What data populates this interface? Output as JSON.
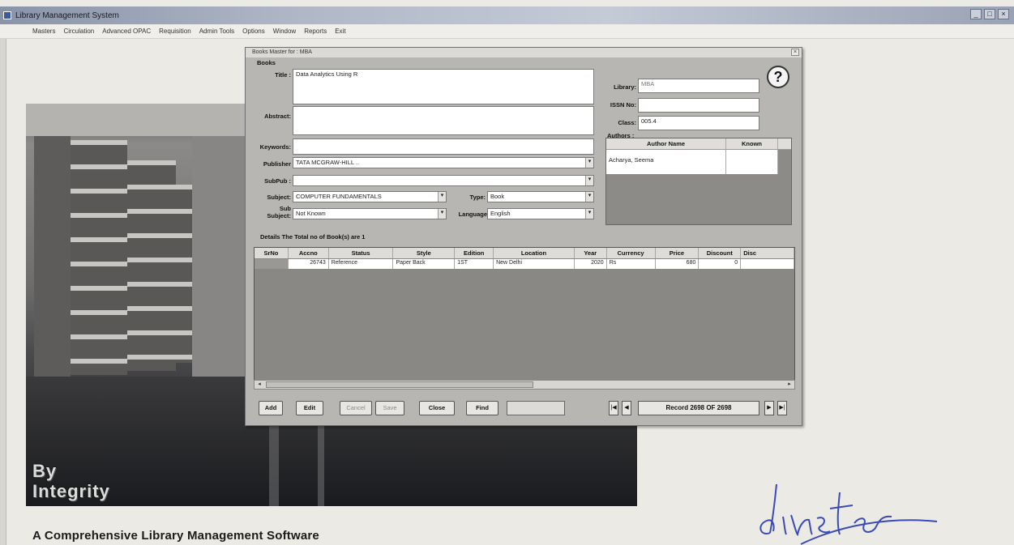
{
  "window": {
    "title": "Library Management System"
  },
  "menu": [
    "Masters",
    "Circulation",
    "Advanced OPAC",
    "Requisition",
    "Admin Tools",
    "Options",
    "Window",
    "Reports",
    "Exit"
  ],
  "dialog": {
    "title": "Books Master for : MBA",
    "section_label": "Books",
    "labels": {
      "title": "Title :",
      "abstract": "Abstract:",
      "keywords": "Keywords:",
      "publisher": "Publisher",
      "subpub": "SubPub :",
      "subject": "Subject:",
      "type": "Type:",
      "sub_subject_1": "Sub",
      "sub_subject_2": "Subject:",
      "language": "Language",
      "library": "Library:",
      "issn": "ISSN No:",
      "class": "Class:",
      "authors": "Authors :"
    },
    "values": {
      "title": "Data Analytics Using R",
      "abstract": "",
      "keywords": "",
      "publisher": "TATA MCGRAW-HILL ..",
      "subpub": "",
      "subject": "COMPUTER FUNDAMENTALS",
      "type": "Book",
      "sub_subject": "Not Known",
      "language": "English",
      "library": "MBA",
      "issn": "",
      "class": "005.4"
    },
    "authors_table": {
      "columns": [
        "Author Name",
        "Known"
      ],
      "rows": [
        [
          "Acharya, Seema",
          ""
        ]
      ]
    },
    "details_title": "Details  The Total no of Book(s) are  1",
    "details_table": {
      "columns": [
        "SrNo",
        "Accno",
        "Status",
        "Style",
        "Edition",
        "Location",
        "Year",
        "Currency",
        "Price",
        "Discount",
        "Disc"
      ],
      "rows": [
        [
          "",
          "26743",
          "Reference",
          "Paper Back",
          "1ST",
          "New Delhi",
          "2020",
          "Rs",
          "680",
          "0",
          ""
        ]
      ]
    },
    "buttons": {
      "add": "Add",
      "edit": "Edit",
      "cancel": "Cancel",
      "save": "Save",
      "close": "Close",
      "find": "Find"
    },
    "record_label": "Record 2698 OF 2698",
    "nav": {
      "first": "|◀",
      "prev": "◀",
      "next": "▶",
      "last": "▶|"
    }
  },
  "background": {
    "brand_line1": "By",
    "brand_line2": "Integrity"
  },
  "tagline": "A Comprehensive Library Management Software"
}
